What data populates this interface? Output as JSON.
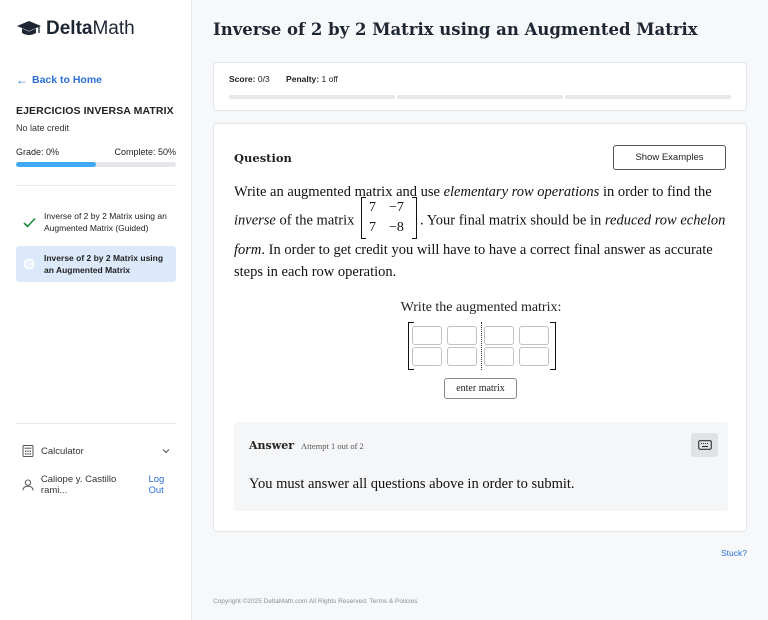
{
  "sidebar": {
    "logo_bold": "Delta",
    "logo_light": "Math",
    "back_label": "Back to Home",
    "assignment_title": "EJERCICIOS INVERSA MATRIX",
    "late_credit": "No late credit",
    "grade_label": "Grade: 0%",
    "complete_label": "Complete: 50%",
    "complete_fraction": 0.5,
    "problems": [
      {
        "label": "Inverse of 2 by 2 Matrix using an Augmented Matrix (Guided)",
        "status": "complete"
      },
      {
        "label": "Inverse of 2 by 2 Matrix using an Augmented Matrix",
        "status": "current"
      }
    ],
    "calculator_label": "Calculator",
    "user_name": "Caliope y. Castillo rami...",
    "logout_label": "Log Out"
  },
  "main": {
    "title": "Inverse of 2 by 2 Matrix using an Augmented Matrix",
    "score_label": "Score:",
    "score_value": "0/3",
    "penalty_label": "Penalty:",
    "penalty_value": "1 off",
    "question_label": "Question",
    "show_examples_label": "Show Examples",
    "question": {
      "t1": "Write an augmented matrix and use ",
      "t2": "elementary row operations",
      "t3": " in order to find the ",
      "t4": "inverse",
      "t5": " of the matrix",
      "t6": ". Your final matrix should be in ",
      "t7": "reduced row echelon form",
      "t8": ". In order to get credit you will have to have a correct final answer as accurate steps in each row operation.",
      "matrix": [
        [
          "7",
          "−7"
        ],
        [
          "7",
          "−8"
        ]
      ]
    },
    "augmented_label": "Write the augmented matrix:",
    "enter_matrix_label": "enter matrix",
    "answer_label": "Answer",
    "attempt_label": "Attempt 1 out of 2",
    "answer_message": "You must answer all questions above in order to submit.",
    "stuck_label": "Stuck?",
    "footer": "Copyright ©2025 DeltaMath.com All Rights Reserved. Terms & Policies"
  },
  "colors": {
    "accent": "#2b6fd6",
    "progress": "#3fa9f5",
    "check": "#1a8f3c",
    "current_bg": "#dbe9fb"
  }
}
